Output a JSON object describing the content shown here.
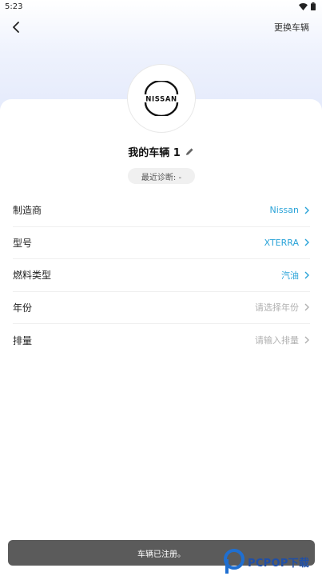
{
  "status_bar": {
    "time": "5:23"
  },
  "header": {
    "change_vehicle_label": "更换车辆"
  },
  "brand": {
    "logo_text": "NISSAN"
  },
  "vehicle": {
    "name": "我的车辆 1",
    "last_diagnosis": "最近诊断: -"
  },
  "fields": [
    {
      "label": "制造商",
      "value": "Nissan",
      "filled": true
    },
    {
      "label": "型号",
      "value": "XTERRA",
      "filled": true
    },
    {
      "label": "燃料类型",
      "value": "汽油",
      "filled": true
    },
    {
      "label": "年份",
      "value": "请选择年份",
      "filled": false
    },
    {
      "label": "排量",
      "value": "请输入排量",
      "filled": false
    }
  ],
  "toast": {
    "message": "车辆已注册。"
  },
  "watermark": {
    "text": "PCPOP下载"
  },
  "colors": {
    "accent": "#2aa3d8",
    "placeholder": "#b0b0b0",
    "toast_bg": "#5b5b5b"
  }
}
